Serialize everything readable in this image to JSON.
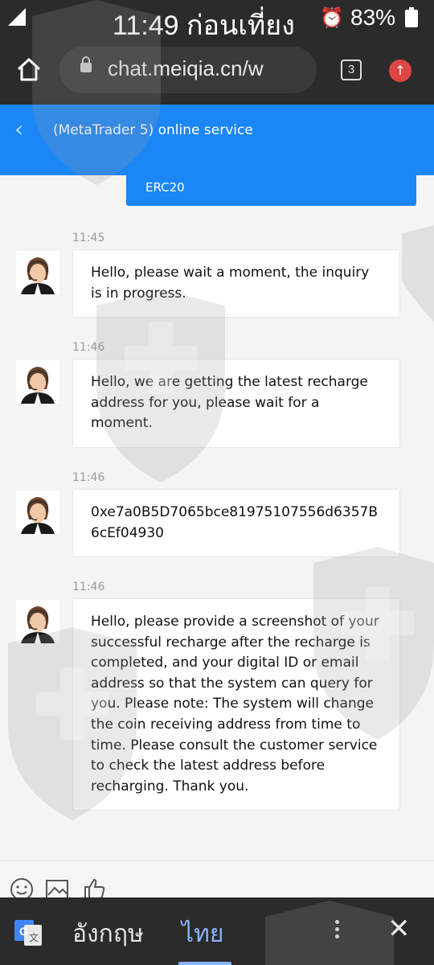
{
  "status_bar": {
    "time": "11:49 ก่อนเที่ยง",
    "alarm_icon": "⏰",
    "battery": "83%"
  },
  "browser": {
    "url": "chat.meiqia.cn/w",
    "tab_count": "3"
  },
  "header": {
    "back_icon": "‹",
    "title": "(MetaTrader 5) online service"
  },
  "chat": {
    "tab_label": "ERC20",
    "messages": [
      {
        "time": "11:45",
        "text": "Hello, please wait a moment, the inquiry is in progress."
      },
      {
        "time": "11:46",
        "text": "Hello, we are getting the latest recharge address for you, please wait for a moment."
      },
      {
        "time": "11:46",
        "text": "0xe7a0B5D7065bce81975107556d6357B6cEf04930"
      },
      {
        "time": "11:46",
        "text": "Hello, please provide a screenshot of your successful recharge after the recharge is completed, and your digital ID or email address so that the system can query for you. Please note: The system will change the coin receiving address from time to time. Please consult the customer service to check the latest address before recharging. Thank you."
      }
    ]
  },
  "translate_bar": {
    "source_lang": "อังกฤษ",
    "target_lang": "ไทย",
    "close_icon": "✕"
  },
  "colors": {
    "accent": "#1b86f5",
    "dark_bar": "#2b2b2b",
    "translate_active": "#8ab4f8"
  }
}
